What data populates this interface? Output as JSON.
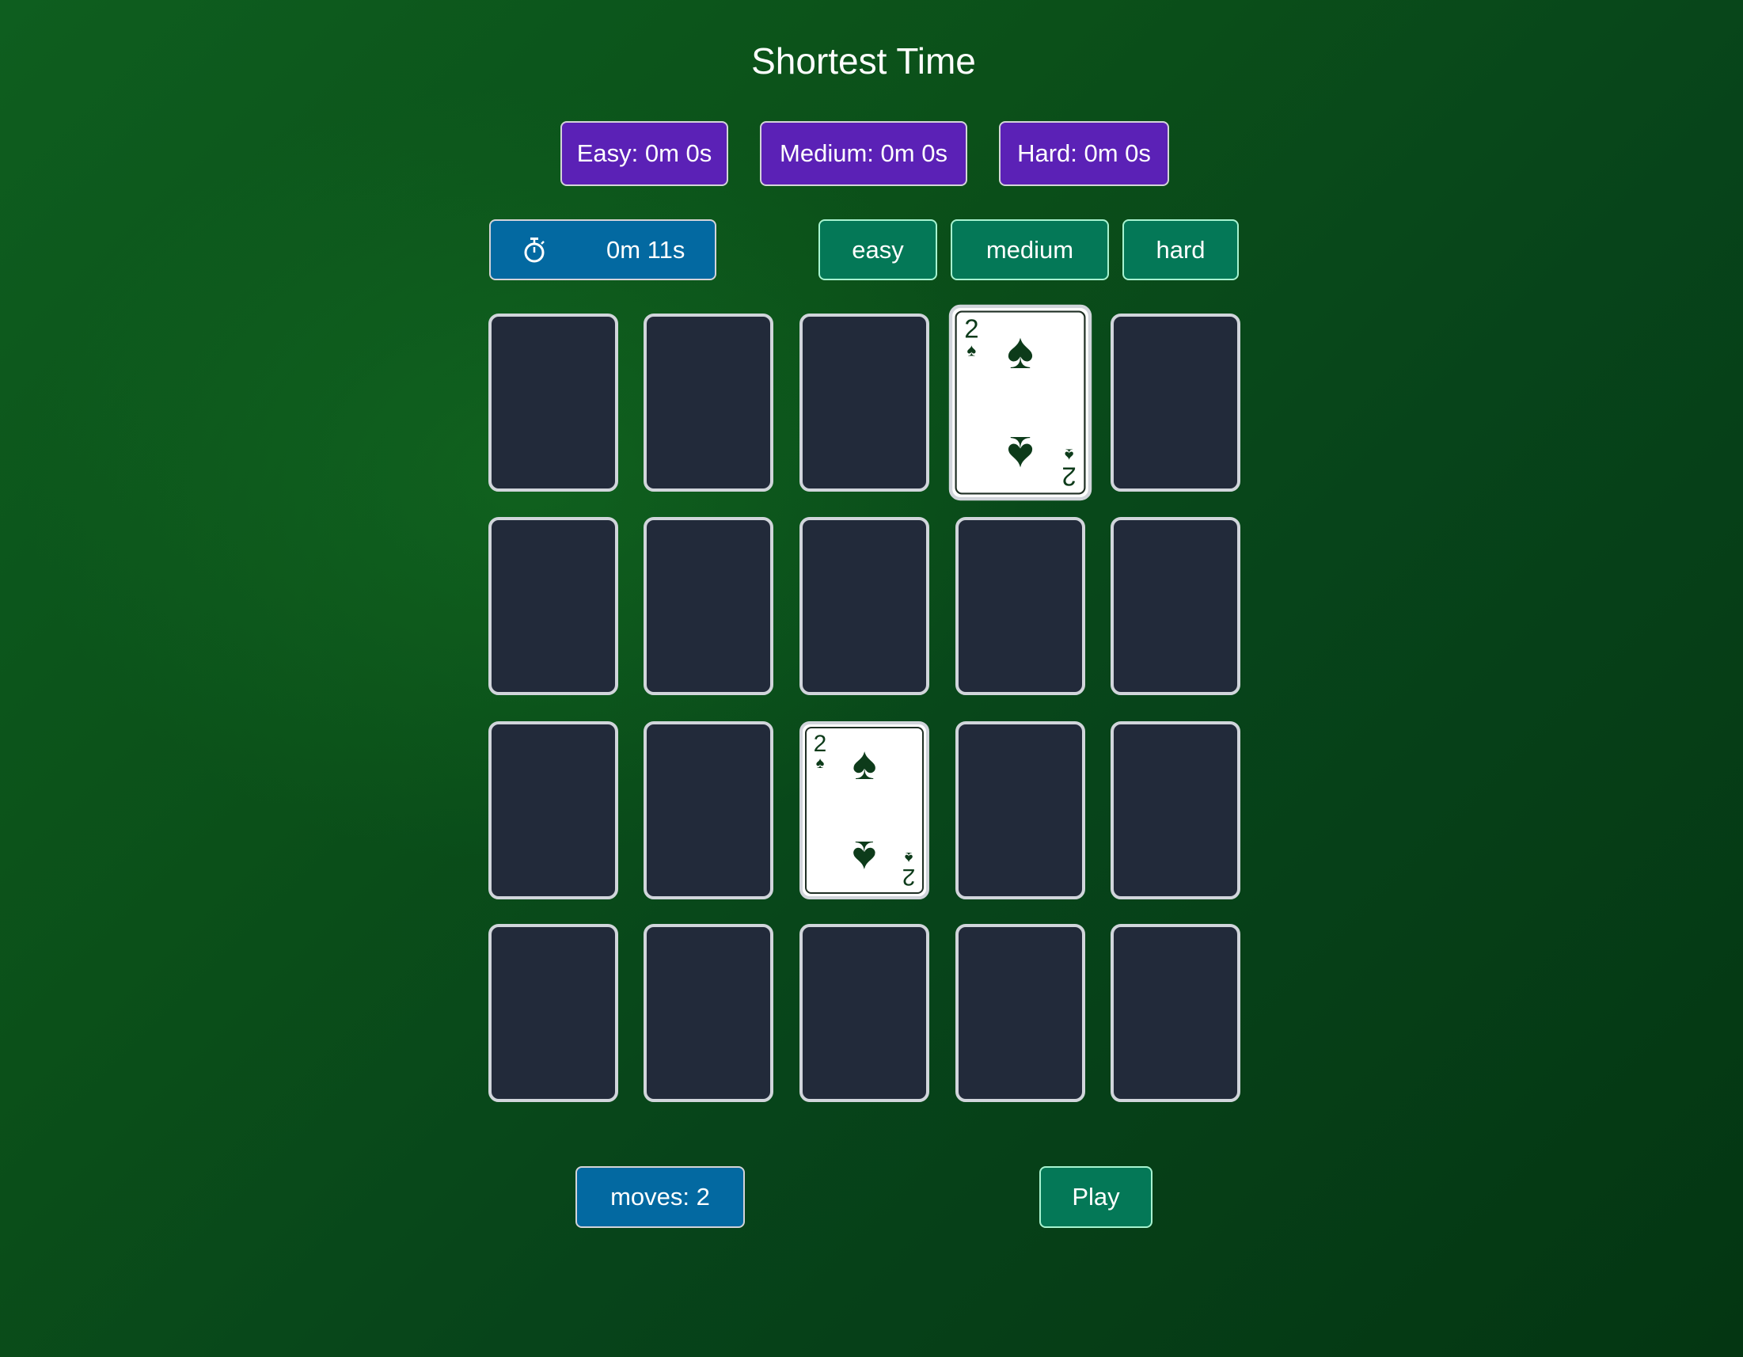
{
  "title": "Shortest Time",
  "records": [
    {
      "label": "Easy: 0m 0s"
    },
    {
      "label": "Medium: 0m 0s"
    },
    {
      "label": "Hard: 0m 0s"
    }
  ],
  "timer": {
    "icon": "stopwatch-icon",
    "value": "0m 11s"
  },
  "levels": [
    {
      "label": "easy"
    },
    {
      "label": "medium"
    },
    {
      "label": "hard"
    }
  ],
  "board": {
    "rows": 4,
    "cols": 5,
    "face_up": [
      {
        "row": 1,
        "col": 4,
        "rank": "2",
        "suit": "♠",
        "suit_name": "spades"
      },
      {
        "row": 3,
        "col": 3,
        "rank": "2",
        "suit": "♠",
        "suit_name": "spades"
      }
    ]
  },
  "moves": {
    "label": "moves: 2",
    "count": 2
  },
  "play": {
    "label": "Play"
  },
  "colors": {
    "record_bg": "#5b21b6",
    "timer_bg": "#0369a1",
    "level_bg": "#047857",
    "card_back": "#222a3a",
    "suit_color": "#0d3b1a",
    "table_green": "#0b5019"
  }
}
